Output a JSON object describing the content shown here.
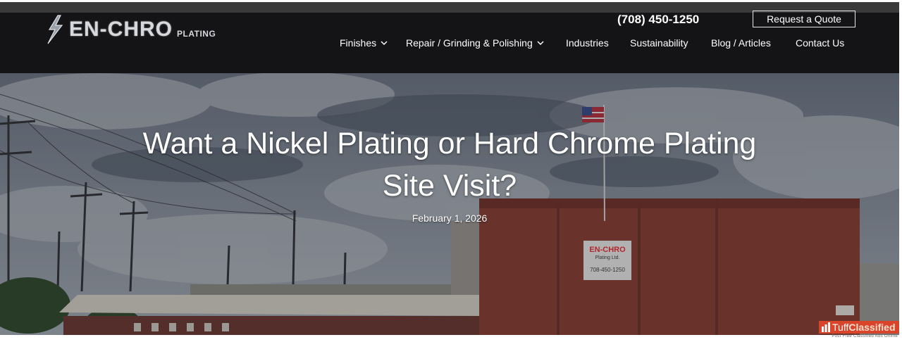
{
  "header": {
    "logo_text": "EN-CHRO",
    "logo_subtext": "PLATING",
    "phone": "(708) 450-1250",
    "quote_button": "Request a Quote"
  },
  "nav": {
    "items": [
      {
        "label": "Finishes",
        "dropdown": true
      },
      {
        "label": "Repair / Grinding & Polishing",
        "dropdown": true
      },
      {
        "label": "Industries",
        "dropdown": false
      },
      {
        "label": "Sustainability",
        "dropdown": false
      },
      {
        "label": "Blog / Articles",
        "dropdown": false
      },
      {
        "label": "Contact Us",
        "dropdown": false
      }
    ]
  },
  "hero": {
    "title_line1": "Want a Nickel Plating or Hard Chrome Plating",
    "title_line2": "Site Visit?",
    "date": "February 1, 2026",
    "building_sign_line1": "EN-CHRO",
    "building_sign_line2": "Plating Ltd.",
    "building_sign_phone": "708-450-1250"
  },
  "watermark": {
    "brand_part1": "Tuff",
    "brand_part2": "Classified",
    "tagline": "Post Free Classified Ads Online"
  },
  "colors": {
    "header_bg": "#141416",
    "brick": "#8a3f33",
    "watermark": "#d8452a"
  }
}
